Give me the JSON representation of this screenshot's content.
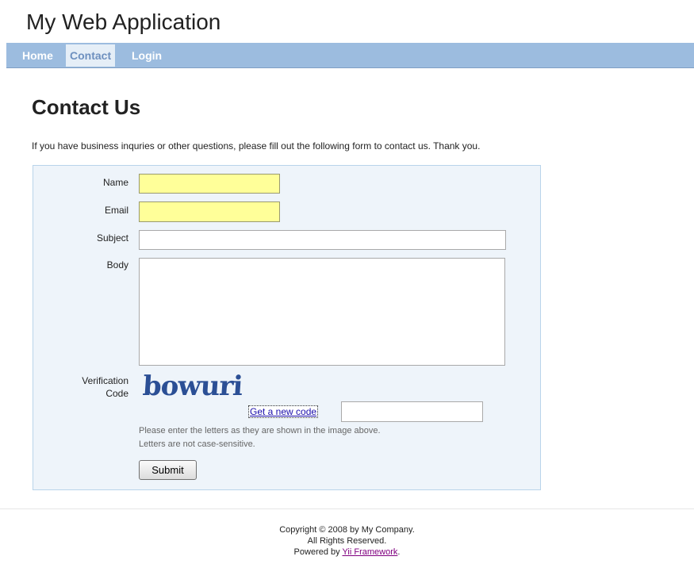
{
  "app": {
    "title": "My Web Application"
  },
  "nav": {
    "items": [
      {
        "label": "Home",
        "active": false
      },
      {
        "label": "Contact",
        "active": true
      },
      {
        "label": "Login",
        "active": false
      }
    ]
  },
  "page": {
    "title": "Contact Us",
    "intro": "If you have business inquries or other questions, please fill out the following form to contact us. Thank you."
  },
  "form": {
    "name_label": "Name",
    "name_value": "",
    "email_label": "Email",
    "email_value": "",
    "subject_label": "Subject",
    "subject_value": "",
    "body_label": "Body",
    "body_value": "",
    "verification_label_line1": "Verification",
    "verification_label_line2": "Code",
    "captcha_text": "bowuri",
    "new_code_link": "Get a new code",
    "verify_value": "",
    "hint_line1": "Please enter the letters as they are shown in the image above.",
    "hint_line2": "Letters are not case-sensitive.",
    "submit_label": "Submit"
  },
  "footer": {
    "copyright": "Copyright © 2008 by My Company.",
    "rights": "All Rights Reserved.",
    "powered_prefix": "Powered by",
    "framework_link": "Yii Framework",
    "powered_suffix": "."
  },
  "colors": {
    "navbar": "#9cbcdf",
    "nav_active_bg": "#e5eef7",
    "form_bg": "#eef4fa",
    "required_field": "#ffff99",
    "captcha_text": "#2b4f95"
  }
}
